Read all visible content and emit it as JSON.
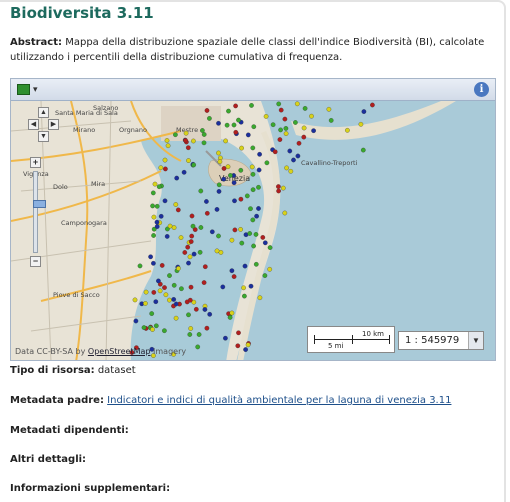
{
  "title": "Biodiversita 3.11",
  "abstract": {
    "label": "Abstract:",
    "text": "Mappa della distribuzione spaziale delle classi dell'indice Biodiversità (BI), calcolate utilizzando i percentili della distribuzione cumulativa di frequenza."
  },
  "map": {
    "place_labels": [
      "Salzano",
      "Santa Maria di Sala",
      "Mirano",
      "Orgnano",
      "Mestre",
      "Vigonza",
      "Dolo",
      "Mira",
      "Camponogara",
      "Piove di Sacco",
      "Venezia",
      "Cavallino-Treporti"
    ],
    "scale": {
      "km": "10 km",
      "mi": "5 mi"
    },
    "scale_value": "1 : 545979",
    "attribution_prefix": "Data CC-BY-SA by",
    "attribution_link": "OpenStreetMap",
    "attribution_suffix": "Imagery",
    "point_colors": {
      "green": "#3aa82e",
      "yellow": "#d8d21a",
      "red": "#b11f1f",
      "blue": "#1b2f9c"
    }
  },
  "fields": {
    "tipo_label": "Tipo di risorsa:",
    "tipo_value": "dataset",
    "padre_label": "Metadata padre:",
    "padre_link": "Indicatori e indici di qualità ambientale per la laguna di venezia 3.11",
    "dipendenti_label": "Metadati dipendenti:",
    "altri_label": "Altri dettagli:",
    "info_label": "Informazioni supplementari:"
  }
}
